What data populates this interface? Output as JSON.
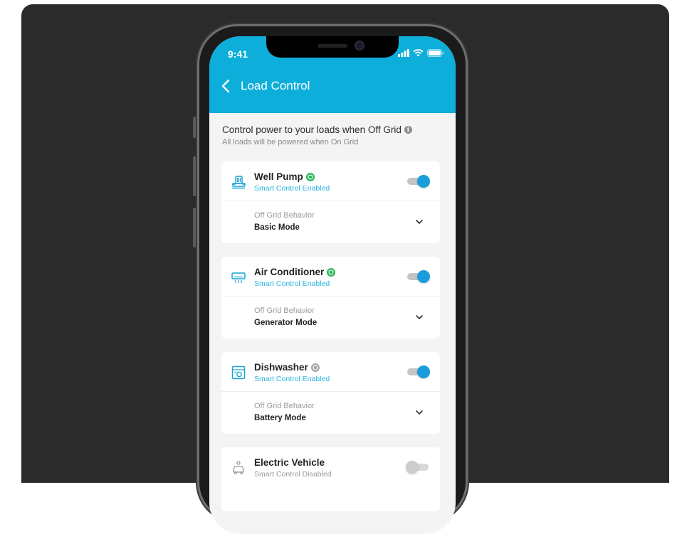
{
  "status_bar": {
    "time": "9:41"
  },
  "header": {
    "title": "Load Control"
  },
  "intro": {
    "title": "Control power to your loads when Off Grid",
    "subtitle": "All loads will be powered when On Grid"
  },
  "colors": {
    "accent": "#0eaedb",
    "toggle_on": "#1a9edb",
    "badge_green": "#2eb85c"
  },
  "loads": [
    {
      "name": "Well Pump",
      "icon": "water-pump-icon",
      "status": "Smart Control Enabled",
      "enabled": true,
      "badge": "green",
      "behavior_label": "Off Grid Behavior",
      "behavior_value": "Basic Mode"
    },
    {
      "name": "Air Conditioner",
      "icon": "air-conditioner-icon",
      "status": "Smart Control Enabled",
      "enabled": true,
      "badge": "green",
      "behavior_label": "Off Grid Behavior",
      "behavior_value": "Generator Mode"
    },
    {
      "name": "Dishwasher",
      "icon": "dishwasher-icon",
      "status": "Smart Control Enabled",
      "enabled": true,
      "badge": "grey",
      "behavior_label": "Off Grid Behavior",
      "behavior_value": "Battery Mode"
    },
    {
      "name": "Electric Vehicle",
      "icon": "ev-charger-icon",
      "status": "Smart Control Disabled",
      "enabled": false
    }
  ]
}
